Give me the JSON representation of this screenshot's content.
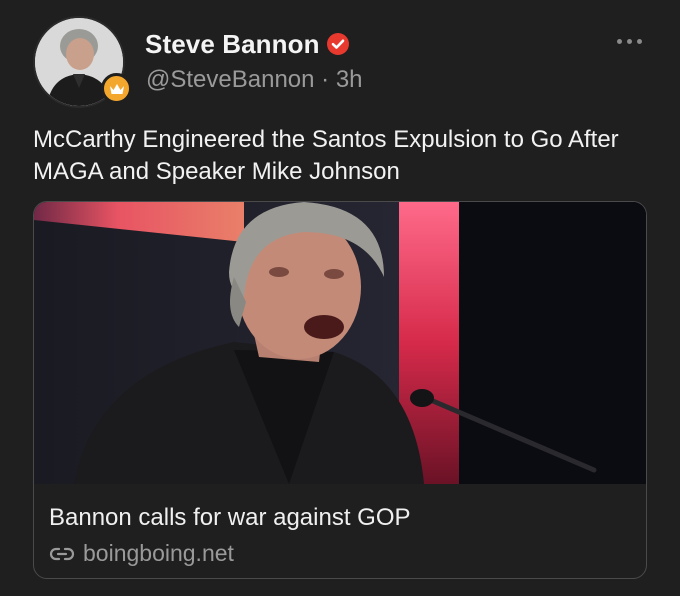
{
  "author": {
    "name": "Steve Bannon",
    "handle": "@SteveBannon",
    "separator": "·",
    "time": "3h"
  },
  "post": {
    "text": "McCarthy Engineered the Santos Expulsion to Go After MAGA and Speaker Mike Johnson"
  },
  "link_card": {
    "title": "Bannon calls for war against GOP",
    "domain": "boingboing.net"
  },
  "colors": {
    "background": "#1f1f1f",
    "verified": "#e8392f",
    "badge": "#f4a72d",
    "muted_text": "#9a9a9a"
  },
  "icons": {
    "verified": "verified-check-icon",
    "avatar_badge": "crown-badge-icon",
    "more": "more-horizontal-icon",
    "link": "link-icon"
  }
}
